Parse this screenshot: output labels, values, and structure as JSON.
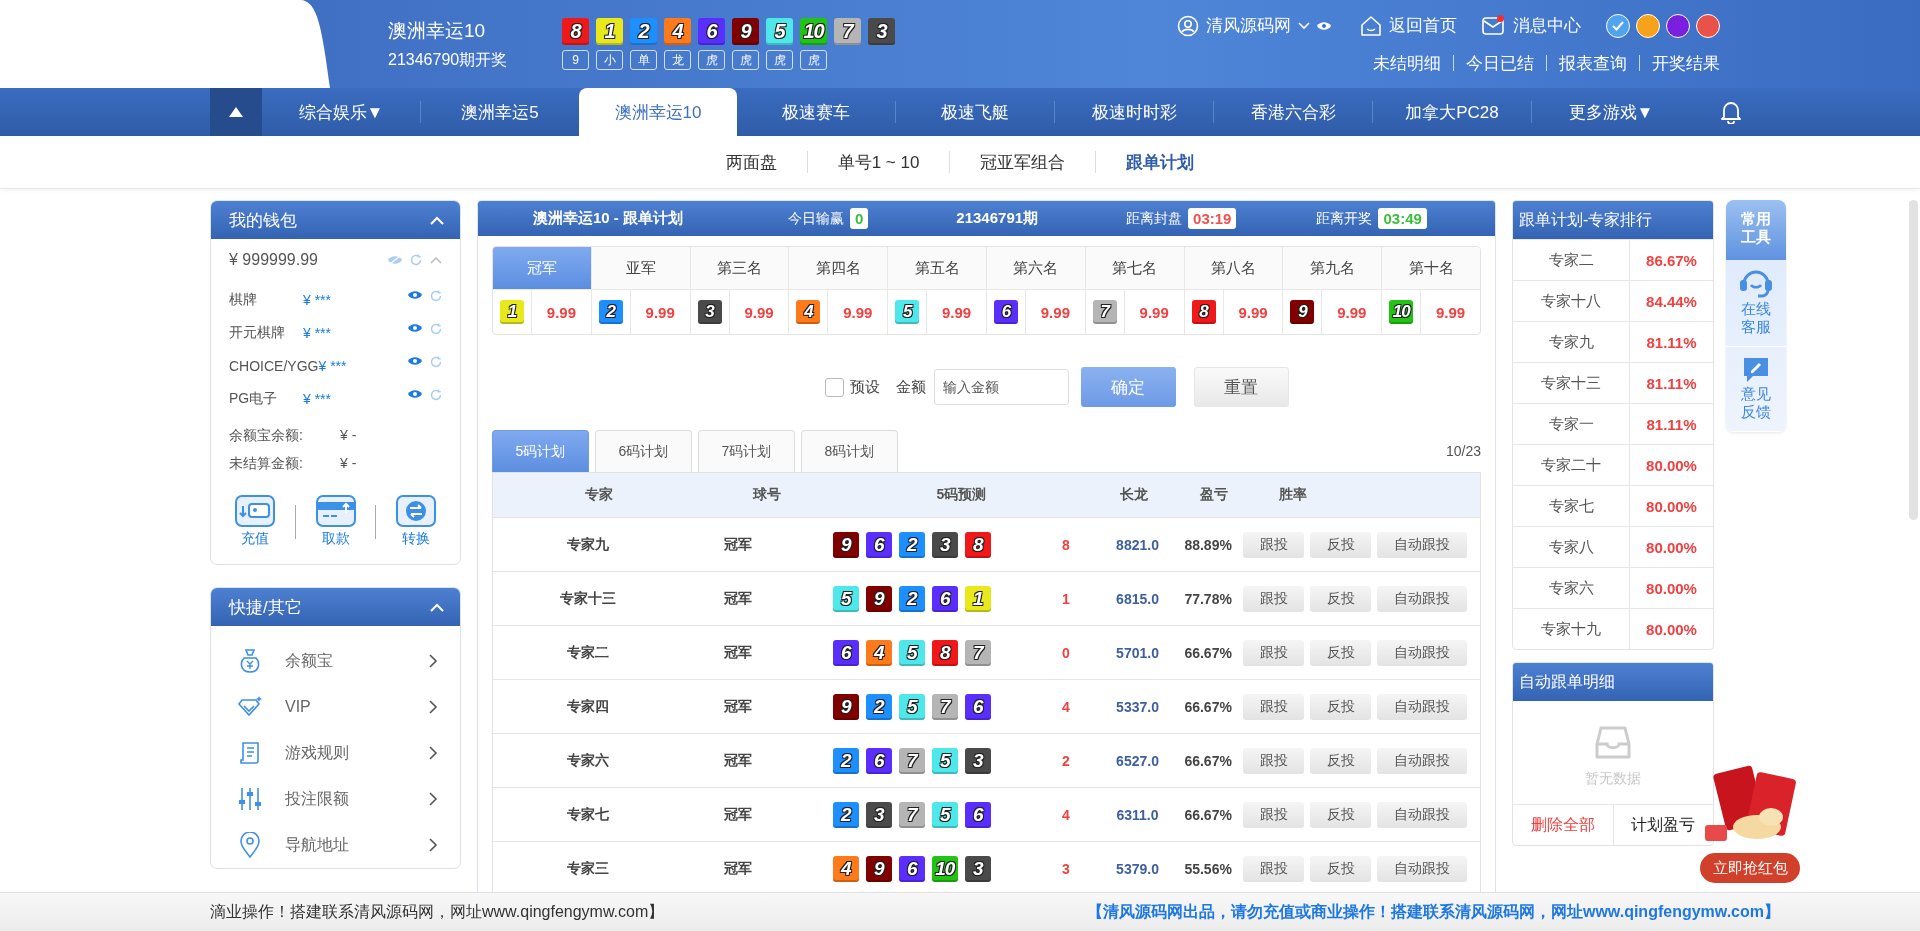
{
  "header": {
    "title": "澳洲幸运10",
    "draw_label": "21346790期开奖",
    "balls": [
      {
        "n": "8",
        "color": "#f01818"
      },
      {
        "n": "1",
        "color": "#e8e81c"
      },
      {
        "n": "2",
        "color": "#1e8fff"
      },
      {
        "n": "4",
        "color": "#ff7a1a"
      },
      {
        "n": "6",
        "color": "#5a2eff"
      },
      {
        "n": "9",
        "color": "#800000"
      },
      {
        "n": "5",
        "color": "#4fe8ea"
      },
      {
        "n": "10",
        "color": "#22c414"
      },
      {
        "n": "7",
        "color": "#b5b5b5"
      },
      {
        "n": "3",
        "color": "#4a4a4a"
      }
    ],
    "tags": [
      "9",
      "小",
      "单",
      "龙",
      "虎",
      "虎",
      "虎",
      "虎"
    ],
    "user": "清风源码网",
    "home": "返回首页",
    "messages": "消息中心",
    "has_unread": true,
    "themes": [
      {
        "color": "#4fa3ef",
        "selected": true
      },
      {
        "color": "#f7a21b",
        "selected": false
      },
      {
        "color": "#7a1ee0",
        "selected": false
      },
      {
        "color": "#e8524a",
        "selected": false
      }
    ],
    "links": [
      "未结明细",
      "今日已结",
      "报表查询",
      "开奖结果"
    ]
  },
  "nav": {
    "items": [
      {
        "label": "综合娱乐▼",
        "selected": false
      },
      {
        "label": "澳洲幸运5",
        "selected": false
      },
      {
        "label": "澳洲幸运10",
        "selected": true
      },
      {
        "label": "极速赛车",
        "selected": false
      },
      {
        "label": "极速飞艇",
        "selected": false
      },
      {
        "label": "极速时时彩",
        "selected": false
      },
      {
        "label": "香港六合彩",
        "selected": false
      },
      {
        "label": "加拿大PC28",
        "selected": false
      },
      {
        "label": "更多游戏▼",
        "selected": false
      }
    ]
  },
  "subnav": [
    {
      "label": "两面盘",
      "selected": false
    },
    {
      "label": "单号1 ~ 10",
      "selected": false
    },
    {
      "label": "冠亚军组合",
      "selected": false
    },
    {
      "label": "跟单计划",
      "selected": true
    }
  ],
  "wallet": {
    "title": "我的钱包",
    "total": "¥ 999999.99",
    "accounts": [
      {
        "name": "棋牌",
        "value": "¥ ***"
      },
      {
        "name": "开元棋牌",
        "value": "¥ ***"
      },
      {
        "name": "CHOICE/YGG",
        "value": "¥ ***"
      },
      {
        "name": "PG电子",
        "value": "¥ ***"
      }
    ],
    "balances": [
      {
        "label": "余额宝余额:",
        "value": "¥ -"
      },
      {
        "label": "未结算金额:",
        "value": "¥ -"
      }
    ],
    "actions": [
      "充值",
      "取款",
      "转换"
    ]
  },
  "shortcuts": {
    "title": "快捷/其它",
    "items": [
      "余额宝",
      "VIP",
      "游戏规则",
      "投注限额",
      "导航地址"
    ]
  },
  "plan": {
    "title": "澳洲幸运10 - 跟单计划",
    "today_label": "今日输赢",
    "today_value": "0",
    "issue": "21346791期",
    "close_label": "距离封盘",
    "close_time": "03:19",
    "draw_label": "距离开奖",
    "draw_time": "03:49",
    "positions": [
      {
        "label": "冠军",
        "selected": true,
        "ball": {
          "n": "1",
          "color": "#e8e81c"
        },
        "odds": "9.99"
      },
      {
        "label": "亚军",
        "selected": false,
        "ball": {
          "n": "2",
          "color": "#1e8fff"
        },
        "odds": "9.99"
      },
      {
        "label": "第三名",
        "selected": false,
        "ball": {
          "n": "3",
          "color": "#4a4a4a"
        },
        "odds": "9.99"
      },
      {
        "label": "第四名",
        "selected": false,
        "ball": {
          "n": "4",
          "color": "#ff7a1a"
        },
        "odds": "9.99"
      },
      {
        "label": "第五名",
        "selected": false,
        "ball": {
          "n": "5",
          "color": "#4fe8ea"
        },
        "odds": "9.99"
      },
      {
        "label": "第六名",
        "selected": false,
        "ball": {
          "n": "6",
          "color": "#5a2eff"
        },
        "odds": "9.99"
      },
      {
        "label": "第七名",
        "selected": false,
        "ball": {
          "n": "7",
          "color": "#b5b5b5"
        },
        "odds": "9.99"
      },
      {
        "label": "第八名",
        "selected": false,
        "ball": {
          "n": "8",
          "color": "#f01818"
        },
        "odds": "9.99"
      },
      {
        "label": "第九名",
        "selected": false,
        "ball": {
          "n": "9",
          "color": "#800000"
        },
        "odds": "9.99"
      },
      {
        "label": "第十名",
        "selected": false,
        "ball": {
          "n": "10",
          "color": "#22c414"
        },
        "odds": "9.99"
      }
    ],
    "preset": {
      "label": "预设",
      "checked": false
    },
    "amount_label": "金额",
    "amount_placeholder": "输入金额",
    "confirm": "确定",
    "reset": "重置",
    "tabs": [
      {
        "label": "5码计划",
        "selected": true
      },
      {
        "label": "6码计划",
        "selected": false
      },
      {
        "label": "7码计划",
        "selected": false
      },
      {
        "label": "8码计划",
        "selected": false
      }
    ],
    "page": "10/23",
    "columns": [
      "专家",
      "球号",
      "5码预测",
      "长龙",
      "盈亏",
      "胜率"
    ],
    "rows": [
      {
        "expert": "专家九",
        "position": "冠军",
        "balls": [
          {
            "n": "9",
            "color": "#800000"
          },
          {
            "n": "6",
            "color": "#5a2eff"
          },
          {
            "n": "2",
            "color": "#1e8fff"
          },
          {
            "n": "3",
            "color": "#4a4a4a"
          },
          {
            "n": "8",
            "color": "#f01818"
          }
        ],
        "streak": "8",
        "profit": "8821.0",
        "rate": "88.89%",
        "buttons": [
          "跟投",
          "反投",
          "自动跟投"
        ]
      },
      {
        "expert": "专家十三",
        "position": "冠军",
        "balls": [
          {
            "n": "5",
            "color": "#4fe8ea"
          },
          {
            "n": "9",
            "color": "#800000"
          },
          {
            "n": "2",
            "color": "#1e8fff"
          },
          {
            "n": "6",
            "color": "#5a2eff"
          },
          {
            "n": "1",
            "color": "#e8e81c"
          }
        ],
        "streak": "1",
        "profit": "6815.0",
        "rate": "77.78%",
        "buttons": [
          "跟投",
          "反投",
          "自动跟投"
        ]
      },
      {
        "expert": "专家二",
        "position": "冠军",
        "balls": [
          {
            "n": "6",
            "color": "#5a2eff"
          },
          {
            "n": "4",
            "color": "#ff7a1a"
          },
          {
            "n": "5",
            "color": "#4fe8ea"
          },
          {
            "n": "8",
            "color": "#f01818"
          },
          {
            "n": "7",
            "color": "#b5b5b5"
          }
        ],
        "streak": "0",
        "profit": "5701.0",
        "rate": "66.67%",
        "buttons": [
          "跟投",
          "反投",
          "自动跟投"
        ]
      },
      {
        "expert": "专家四",
        "position": "冠军",
        "balls": [
          {
            "n": "9",
            "color": "#800000"
          },
          {
            "n": "2",
            "color": "#1e8fff"
          },
          {
            "n": "5",
            "color": "#4fe8ea"
          },
          {
            "n": "7",
            "color": "#b5b5b5"
          },
          {
            "n": "6",
            "color": "#5a2eff"
          }
        ],
        "streak": "4",
        "profit": "5337.0",
        "rate": "66.67%",
        "buttons": [
          "跟投",
          "反投",
          "自动跟投"
        ]
      },
      {
        "expert": "专家六",
        "position": "冠军",
        "balls": [
          {
            "n": "2",
            "color": "#1e8fff"
          },
          {
            "n": "6",
            "color": "#5a2eff"
          },
          {
            "n": "7",
            "color": "#b5b5b5"
          },
          {
            "n": "5",
            "color": "#4fe8ea"
          },
          {
            "n": "3",
            "color": "#4a4a4a"
          }
        ],
        "streak": "2",
        "profit": "6527.0",
        "rate": "66.67%",
        "buttons": [
          "跟投",
          "反投",
          "自动跟投"
        ]
      },
      {
        "expert": "专家七",
        "position": "冠军",
        "balls": [
          {
            "n": "2",
            "color": "#1e8fff"
          },
          {
            "n": "3",
            "color": "#4a4a4a"
          },
          {
            "n": "7",
            "color": "#b5b5b5"
          },
          {
            "n": "5",
            "color": "#4fe8ea"
          },
          {
            "n": "6",
            "color": "#5a2eff"
          }
        ],
        "streak": "4",
        "profit": "6311.0",
        "rate": "66.67%",
        "buttons": [
          "跟投",
          "反投",
          "自动跟投"
        ]
      },
      {
        "expert": "专家三",
        "position": "冠军",
        "balls": [
          {
            "n": "4",
            "color": "#ff7a1a"
          },
          {
            "n": "9",
            "color": "#800000"
          },
          {
            "n": "6",
            "color": "#5a2eff"
          },
          {
            "n": "10",
            "color": "#22c414"
          },
          {
            "n": "3",
            "color": "#4a4a4a"
          }
        ],
        "streak": "3",
        "profit": "5379.0",
        "rate": "55.56%",
        "buttons": [
          "跟投",
          "反投",
          "自动跟投"
        ]
      }
    ]
  },
  "ranking": {
    "title": "跟单计划-专家排行",
    "rows": [
      {
        "name": "专家二",
        "rate": "86.67%"
      },
      {
        "name": "专家十八",
        "rate": "84.44%"
      },
      {
        "name": "专家九",
        "rate": "81.11%"
      },
      {
        "name": "专家十三",
        "rate": "81.11%"
      },
      {
        "name": "专家一",
        "rate": "81.11%"
      },
      {
        "name": "专家二十",
        "rate": "80.00%"
      },
      {
        "name": "专家七",
        "rate": "80.00%"
      },
      {
        "name": "专家八",
        "rate": "80.00%"
      },
      {
        "name": "专家六",
        "rate": "80.00%"
      },
      {
        "name": "专家十九",
        "rate": "80.00%"
      }
    ]
  },
  "auto_follow": {
    "title": "自动跟单明细",
    "empty": "暂无数据",
    "delete_all": "删除全部",
    "plan_profit": "计划盈亏"
  },
  "tools": {
    "title": "常用工具",
    "items": [
      "在线客服",
      "意见反馈"
    ]
  },
  "red_packet": "立即抢红包",
  "marquee": {
    "left": "滴业操作！搭建联系清风源码网，网址www.qingfengymw.com】",
    "right": "【清风源码网出品，请勿充值或商业操作！搭建联系清风源码网，网址www.qingfengymw.com】"
  }
}
